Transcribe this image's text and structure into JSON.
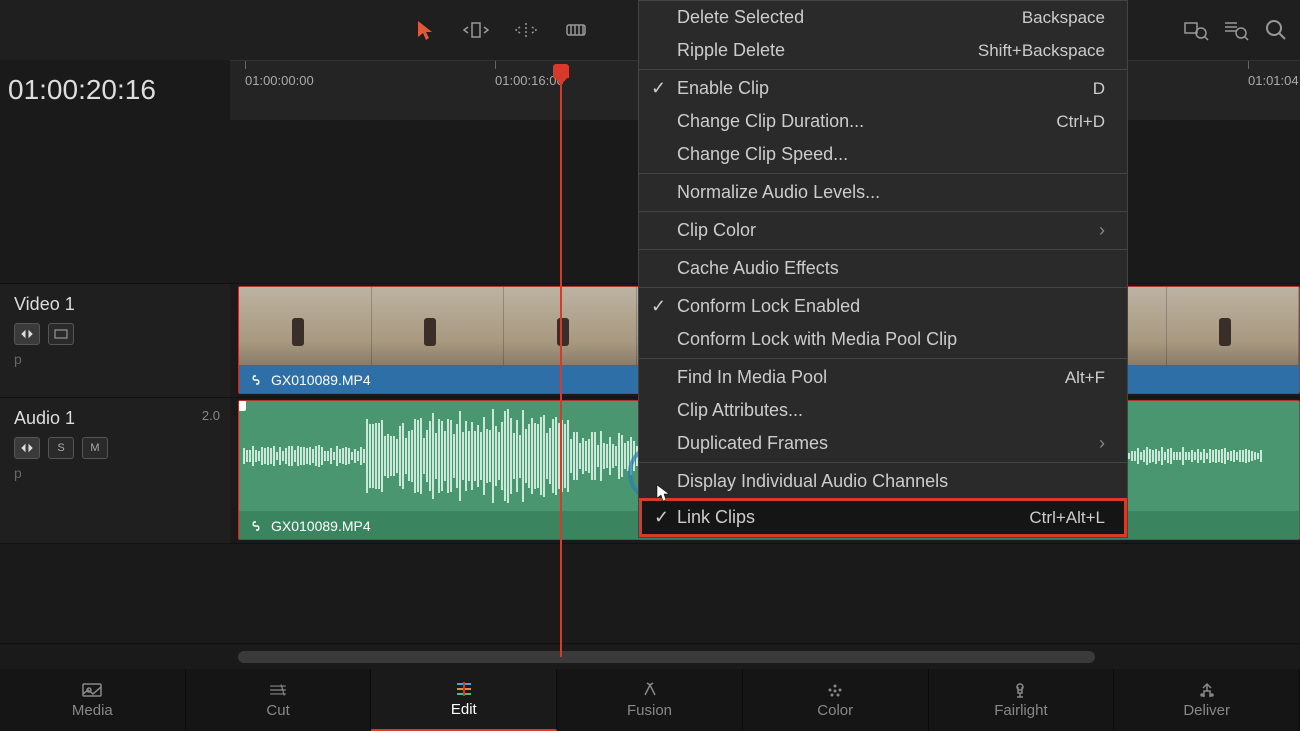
{
  "timecode": "01:00:20:16",
  "ruler": {
    "t1": "01:00:00:00",
    "t2": "01:00:16:00",
    "t3": "01:01:04"
  },
  "tracks": {
    "video": {
      "name": "Video 1",
      "clip_filename": "GX010089.MP4"
    },
    "audio": {
      "name": "Audio 1",
      "channels": "2.0",
      "clip_filename": "GX010089.MP4",
      "solo": "S",
      "mute": "M"
    },
    "p": "p"
  },
  "nav": {
    "media": "Media",
    "cut": "Cut",
    "edit": "Edit",
    "fusion": "Fusion",
    "color": "Color",
    "fairlight": "Fairlight",
    "deliver": "Deliver"
  },
  "menu": {
    "delete_selected": "Delete Selected",
    "delete_selected_sc": "Backspace",
    "ripple_delete": "Ripple Delete",
    "ripple_delete_sc": "Shift+Backspace",
    "enable_clip": "Enable Clip",
    "enable_clip_sc": "D",
    "change_duration": "Change Clip Duration...",
    "change_duration_sc": "Ctrl+D",
    "change_speed": "Change Clip Speed...",
    "normalize_audio": "Normalize Audio Levels...",
    "clip_color": "Clip Color",
    "cache_audio": "Cache Audio Effects",
    "conform_lock": "Conform Lock Enabled",
    "conform_lock_media": "Conform Lock with Media Pool Clip",
    "find_media_pool": "Find In Media Pool",
    "find_media_pool_sc": "Alt+F",
    "clip_attributes": "Clip Attributes...",
    "duplicated_frames": "Duplicated Frames",
    "display_channels": "Display Individual Audio Channels",
    "link_clips": "Link Clips",
    "link_clips_sc": "Ctrl+Alt+L"
  }
}
